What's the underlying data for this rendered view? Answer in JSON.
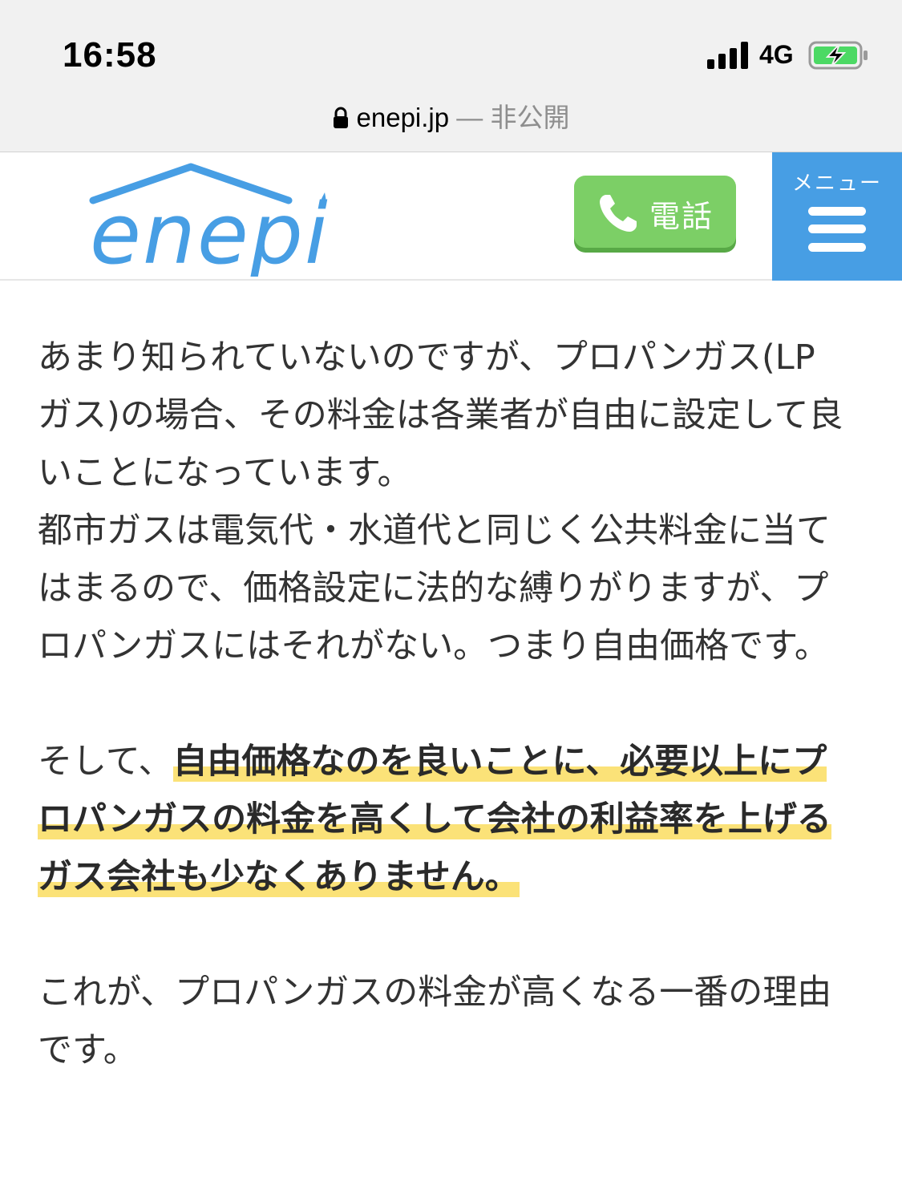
{
  "status_bar": {
    "time": "16:58",
    "network": "4G",
    "battery_icon": "battery-charging-icon",
    "signal_icon": "signal-bars-icon"
  },
  "url_bar": {
    "domain": "enepi.jp",
    "separator": " — ",
    "status": "非公開"
  },
  "header": {
    "logo_text": "enepi",
    "phone_label": "電話",
    "menu_label": "メニュー",
    "colors": {
      "brand_blue": "#479ee4",
      "phone_green": "#7ccf66"
    }
  },
  "article": {
    "p1": "あまり知られていないのですが、プロパンガス(LPガス)の場合、その料金は各業者が自由に設定して良いことになっています。",
    "p2": "都市ガスは電気代・水道代と同じく公共料金に当てはまるので、価格設定に法的な縛りがりますが、プロパンガスにはそれがない。つまり自由価格です。",
    "p3_lead": "そして、",
    "p3_highlight": "自由価格なのを良いことに、必要以上にプロパンガスの料金を高くして会社の利益率を上げるガス会社も少なくありません。",
    "p4": "これが、プロパンガスの料金が高くなる一番の理由です。",
    "highlight_color": "#fbe278"
  }
}
